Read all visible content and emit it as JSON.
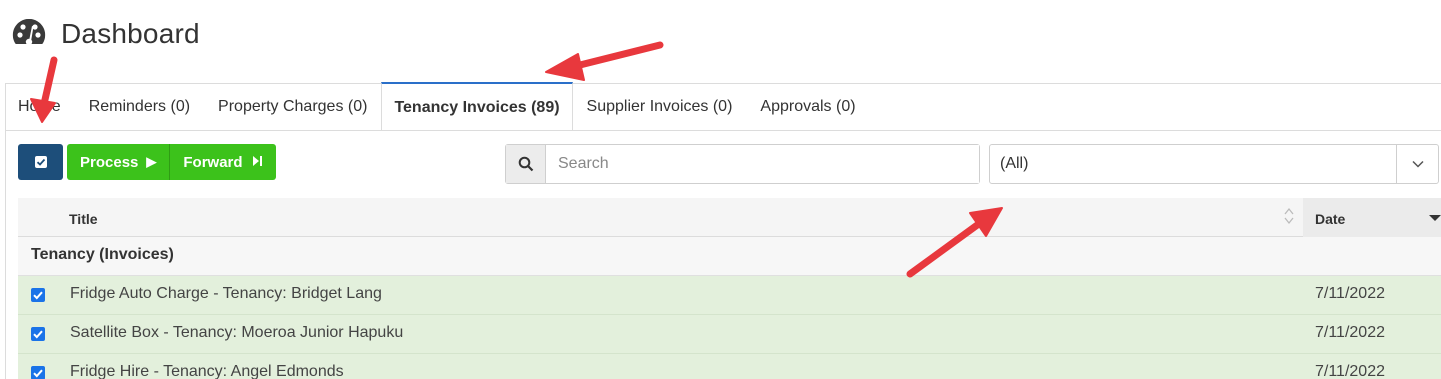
{
  "header": {
    "title": "Dashboard",
    "icon": "gauge-icon"
  },
  "tabs": [
    {
      "label": "Home",
      "active": false
    },
    {
      "label": "Reminders (0)",
      "active": false
    },
    {
      "label": "Property Charges (0)",
      "active": false
    },
    {
      "label": "Tenancy Invoices (89)",
      "active": true
    },
    {
      "label": "Supplier Invoices (0)",
      "active": false
    },
    {
      "label": "Approvals (0)",
      "active": false
    }
  ],
  "toolbar": {
    "process_label": "Process",
    "forward_label": "Forward"
  },
  "search": {
    "placeholder": "Search",
    "value": ""
  },
  "filter": {
    "selected": "(All)"
  },
  "grid": {
    "columns": {
      "title": "Title",
      "date": "Date"
    },
    "group_label": "Tenancy (Invoices)",
    "rows": [
      {
        "title": "Fridge Auto Charge - Tenancy: Bridget Lang",
        "date": "7/11/2022",
        "checked": true
      },
      {
        "title": "Satellite Box - Tenancy: Moeroa Junior Hapuku",
        "date": "7/11/2022",
        "checked": true
      },
      {
        "title": "Fridge Hire - Tenancy: Angel Edmonds",
        "date": "7/11/2022",
        "checked": true
      }
    ]
  },
  "colors": {
    "accent_tab": "#2a6fc9",
    "primary_dark": "#1d4e7a",
    "process_green": "#3cc21b",
    "row_selected": "#e3f0dc",
    "annotation_arrow": "#e8383d"
  }
}
